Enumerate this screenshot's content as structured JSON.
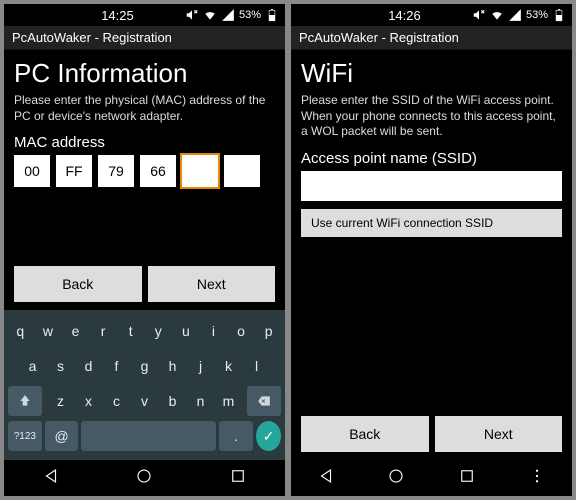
{
  "left": {
    "status": {
      "time": "14:25",
      "battery": "53%"
    },
    "header": "PcAutoWaker - Registration",
    "title": "PC Information",
    "desc": "Please enter the physical (MAC) address of the PC or device's network adapter.",
    "field_label": "MAC address",
    "mac": [
      "00",
      "FF",
      "79",
      "66",
      "",
      ""
    ],
    "back": "Back",
    "next": "Next",
    "keys_row1": [
      "q",
      "w",
      "e",
      "r",
      "t",
      "y",
      "u",
      "i",
      "o",
      "p"
    ],
    "keys_row2": [
      "a",
      "s",
      "d",
      "f",
      "g",
      "h",
      "j",
      "k",
      "l"
    ],
    "keys_row3": [
      "z",
      "x",
      "c",
      "v",
      "b",
      "n",
      "m"
    ],
    "sym_key": "?123",
    "at_key": "@",
    "dot_key": "."
  },
  "right": {
    "status": {
      "time": "14:26",
      "battery": "53%"
    },
    "header": "PcAutoWaker - Registration",
    "title": "WiFi",
    "desc": "Please enter the SSID of the WiFi access point. When your phone connects to this access point, a WOL packet will be sent.",
    "field_label": "Access point name (SSID)",
    "ssid_value": "",
    "use_ssid_btn": "Use current WiFi connection SSID",
    "back": "Back",
    "next": "Next"
  }
}
